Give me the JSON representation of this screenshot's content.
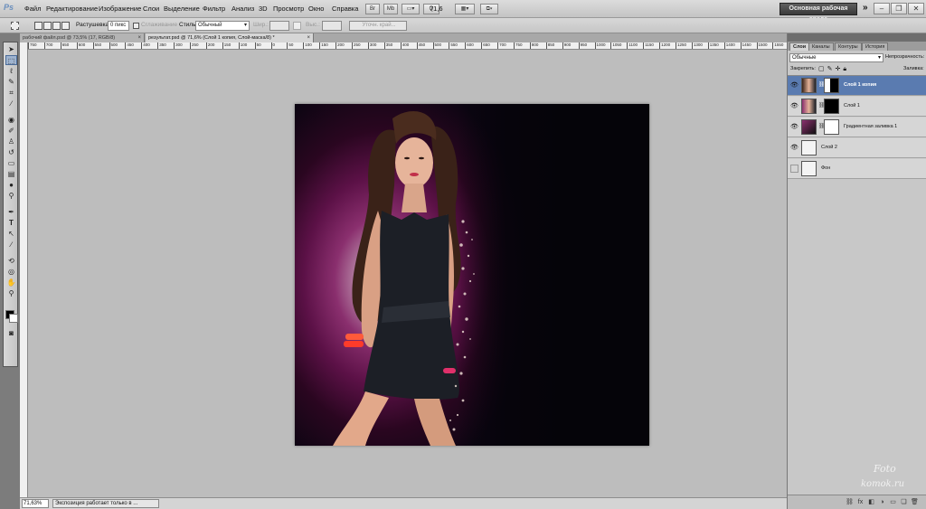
{
  "app": {
    "logo": "Ps"
  },
  "menu": {
    "items": [
      "Файл",
      "Редактирование",
      "Изображение",
      "Слои",
      "Выделение",
      "Фильтр",
      "Анализ",
      "3D",
      "Просмотр",
      "Окно",
      "Справка"
    ],
    "zoom_value": "71,6",
    "workspace": "Основная рабочая среда",
    "more": "»"
  },
  "options": {
    "feather_label": "Растушевка:",
    "feather_value": "0 пикс",
    "antialias_label": "Сглаживание",
    "style_label": "Стиль:",
    "style_value": "Обычный",
    "width_label": "Шир.:",
    "height_label": "Выс.:",
    "refine_label": "Уточн. край..."
  },
  "tabs": [
    {
      "title": "рабочий файл.psd @ 73,5% (17, RGB/8)",
      "close": "×"
    },
    {
      "title": "результат.psd @ 71,6% (Слой 1 копия, Слой-маска/8) *",
      "close": "×"
    }
  ],
  "ruler_labels": [
    "750",
    "700",
    "650",
    "600",
    "550",
    "500",
    "450",
    "400",
    "350",
    "300",
    "250",
    "200",
    "150",
    "100",
    "50",
    "0",
    "50",
    "100",
    "150",
    "200",
    "250",
    "300",
    "350",
    "400",
    "450",
    "500",
    "550",
    "600",
    "650",
    "700",
    "750",
    "800",
    "850",
    "900",
    "950",
    "1000",
    "1050",
    "1100",
    "1150",
    "1200",
    "1250",
    "1300",
    "1350",
    "1400",
    "1450",
    "1500",
    "1550"
  ],
  "status": {
    "zoom": "71,63%",
    "text": "Экспозиция работает только в ..."
  },
  "panel": {
    "tabs": [
      "Слои",
      "Каналы",
      "Контуры",
      "История"
    ],
    "blend_mode": "Обычные",
    "opacity_label": "Непрозрачность:",
    "lock_label": "Закрепить:",
    "fill_label": "Заливка:",
    "layers": [
      {
        "name": "Слой 1 копия",
        "selected": true,
        "visible": true
      },
      {
        "name": "Слой 1",
        "selected": false,
        "visible": true
      },
      {
        "name": "Градиентная заливка 1",
        "selected": false,
        "visible": true
      },
      {
        "name": "Слой 2",
        "selected": false,
        "visible": true
      },
      {
        "name": "Фон",
        "selected": false,
        "visible": false
      }
    ]
  },
  "watermark": {
    "line1": "Foto",
    "line2": "komok.ru"
  },
  "colors": {
    "selected_layer": "#5a7bb0",
    "workspace_button": "#3a3a3a",
    "accent": "#8a2f6e"
  },
  "icons": {
    "visibility": "eye-icon",
    "link": "chain-link-icon",
    "close": "close-icon",
    "lock": "lock-icon"
  }
}
